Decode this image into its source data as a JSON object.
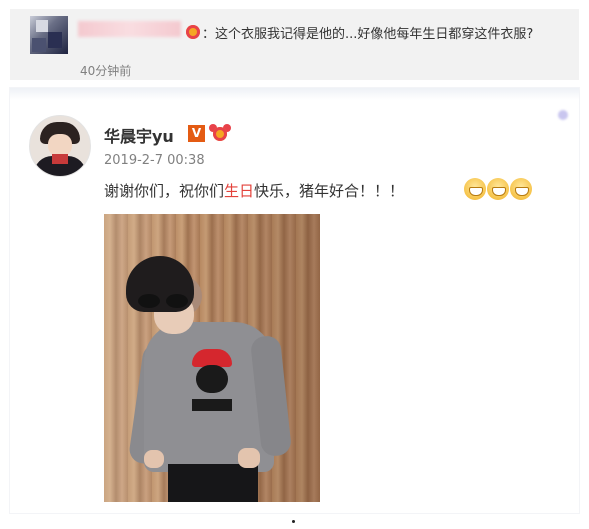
{
  "comment": {
    "text": "：这个衣服我记得是他的...好像他每年生日都穿这件衣服?",
    "time": "40分钟前",
    "icon": "badge-icon"
  },
  "post": {
    "author": "华晨宇yu",
    "verified_label": "V",
    "timestamp": "2019-2-7 00:38",
    "text_before": "谢谢你们，祝你们",
    "text_highlight": "生日",
    "text_after": "快乐，猪年好合！！！",
    "emoji_names": [
      "grin-emoji",
      "grin-emoji",
      "grin-emoji"
    ],
    "highlight_color": "#e3423b",
    "verified_color": "#e45b13"
  }
}
